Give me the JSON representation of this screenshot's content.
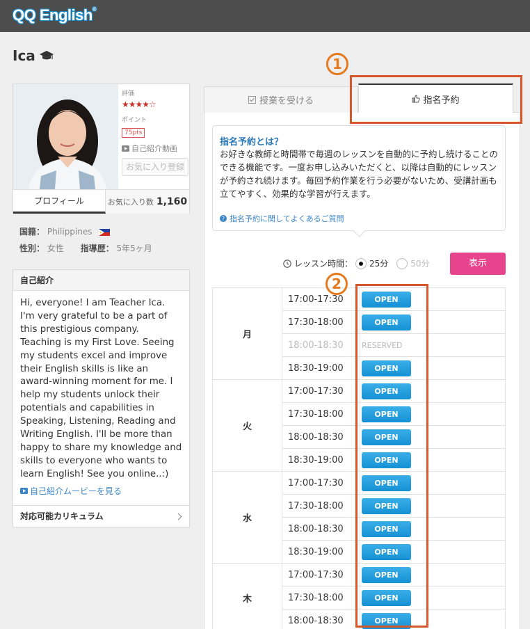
{
  "header": {
    "logo": "QQ English",
    "logo_mark": "®"
  },
  "teacher": {
    "name": "Ica",
    "rating_label": "評価",
    "stars": "★★★★☆",
    "points_label": "ポイント",
    "points": "75pts",
    "video_link": "自己紹介動画",
    "favorite_button": "お気に入り登録",
    "tab_profile": "プロフィール",
    "tab_favorites_label": "お気に入り数",
    "favorites_count": "1,160",
    "nationality_label": "国籍：",
    "nationality": "Philippines",
    "gender_label": "性別：",
    "gender": "女性",
    "experience_label": "指導歴：",
    "experience": "5年5ヶ月"
  },
  "intro": {
    "heading": "自己紹介",
    "text": "Hi, everyone! I am Teacher Ica. I'm very grateful to be a part of this prestigious company. Teaching is my First Love. Seeing my students excel and improve their English skills is like an award-winning moment for me. I help my students unlock their potentials and capabilities in Speaking, Listening, Reading and Writing English. I'll be more than happy to share my knowledge and skills to everyone who wants to learn English! See you online..:)",
    "video_link": "自己紹介ムービーを見る",
    "curriculum_link": "対応可能カリキュラム"
  },
  "tabs": {
    "lesson": "授業を受ける",
    "reserve": "指名予約"
  },
  "info": {
    "title": "指名予約とは？",
    "text": "お好きな教師と時間帯で毎週のレッスンを自動的に予約し続けることのできる機能です。一度お申し込みいただくと、以降は自動的にレッスンが予約され続けます。毎回予約作業を行う必要がないため、受講計画も立てやすく、効果的な学習が行えます。",
    "faq": "指名予約に関してよくあるご質問"
  },
  "controls": {
    "lesson_time_label": "レッスン時間：",
    "option_25": "25分",
    "option_50": "50分",
    "show_button": "表示"
  },
  "annotations": {
    "one": "1",
    "two": "2"
  },
  "schedule": {
    "open_label": "OPEN",
    "reserved_label": "RESERVED",
    "days": [
      {
        "day": "月",
        "slots": [
          {
            "time": "17:00-17:30",
            "status": "open"
          },
          {
            "time": "17:30-18:00",
            "status": "open"
          },
          {
            "time": "18:00-18:30",
            "status": "reserved"
          },
          {
            "time": "18:30-19:00",
            "status": "open"
          }
        ]
      },
      {
        "day": "火",
        "slots": [
          {
            "time": "17:00-17:30",
            "status": "open"
          },
          {
            "time": "17:30-18:00",
            "status": "open"
          },
          {
            "time": "18:00-18:30",
            "status": "open"
          },
          {
            "time": "18:30-19:00",
            "status": "open"
          }
        ]
      },
      {
        "day": "水",
        "slots": [
          {
            "time": "17:00-17:30",
            "status": "open"
          },
          {
            "time": "17:30-18:00",
            "status": "open"
          },
          {
            "time": "18:00-18:30",
            "status": "open"
          },
          {
            "time": "18:30-19:00",
            "status": "open"
          }
        ]
      },
      {
        "day": "木",
        "slots": [
          {
            "time": "17:00-17:30",
            "status": "open"
          },
          {
            "time": "17:30-18:00",
            "status": "open"
          },
          {
            "time": "18:00-18:30",
            "status": "open"
          }
        ]
      }
    ]
  },
  "colors": {
    "header_bg": "#4d4d4d",
    "accent_pink": "#e8438d",
    "open_blue": "#1591d4",
    "annotation_orange": "#d6572a",
    "link_blue": "#3a85c8"
  }
}
